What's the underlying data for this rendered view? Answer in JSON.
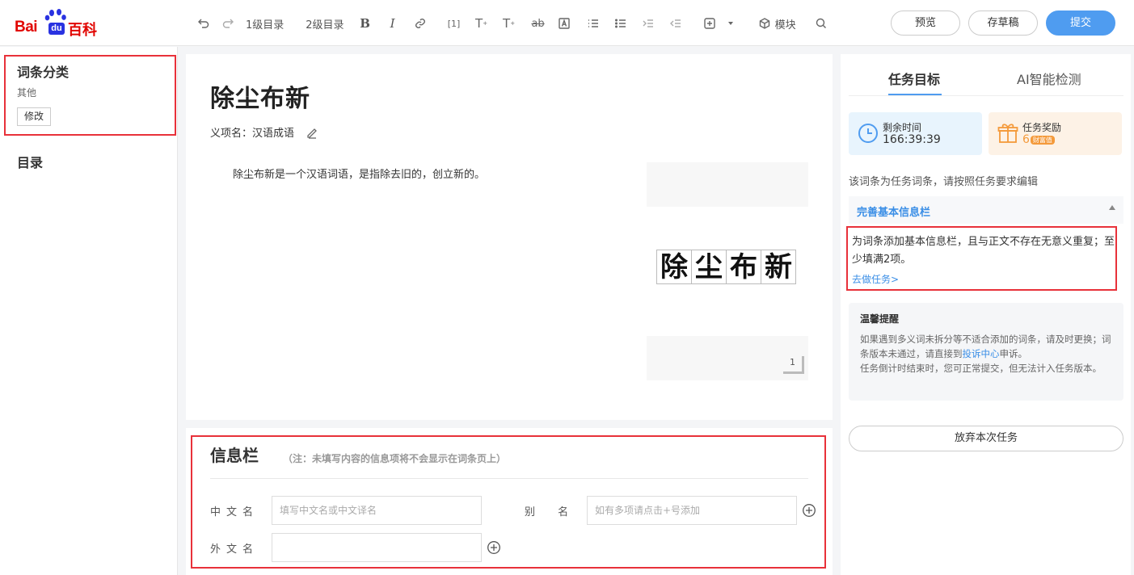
{
  "brand": {
    "bai": "Bai",
    "du": "du",
    "baike": "百科"
  },
  "toolbar": {
    "heading1": "1级目录",
    "heading2": "2级目录",
    "module": "模块",
    "preview": "预览",
    "draft": "存草稿",
    "submit": "提交"
  },
  "left": {
    "category_title": "词条分类",
    "category_value": "其他",
    "category_edit": "修改",
    "toc_title": "目录"
  },
  "entry": {
    "title": "除尘布新",
    "sense_label": "义项名：",
    "sense_value": "汉语成语",
    "body": "除尘布新是一个汉语词语，是指除去旧的，创立新的。",
    "image_chars": [
      "除",
      "尘",
      "布",
      "新"
    ],
    "image_count": "1"
  },
  "infobox": {
    "title": "信息栏",
    "note": "（注：未填写内容的信息项将不会显示在词条页上）",
    "fields": {
      "chinese_name_label": "中文名",
      "chinese_name_placeholder": "填写中文名或中文译名",
      "alias_label": "别 名",
      "alias_placeholder": "如有多项请点击+号添加",
      "foreign_name_label": "外文名",
      "foreign_name_value": ""
    }
  },
  "right": {
    "tab_task": "任务目标",
    "tab_ai": "AI智能检测",
    "time_label": "剩余时间",
    "time_value": "166:39:39",
    "reward_label": "任务奖励",
    "reward_value": "6",
    "reward_unit": "财富值",
    "task_desc": "该词条为任务词条，请按照任务要求编辑",
    "task_head": "完善基本信息栏",
    "task_text": "为词条添加基本信息栏，且与正文不存在无意义重复；至少填满2项。",
    "task_go": "去做任务>",
    "tips_title": "温馨提醒",
    "tips_p1": "如果遇到多义词未拆分等不适合添加的词条，请及时更换；词条版本未通过，请直接到",
    "tips_link": "投诉中心",
    "tips_p1_end": "申诉。",
    "tips_p2": "任务倒计时结束时，您可正常提交，但无法计入任务版本。",
    "abandon": "放弃本次任务"
  },
  "colors": {
    "accent": "#4f9cf0",
    "highlight": "#e8313a",
    "brand_red": "#e10602",
    "brand_blue": "#2932e1"
  }
}
